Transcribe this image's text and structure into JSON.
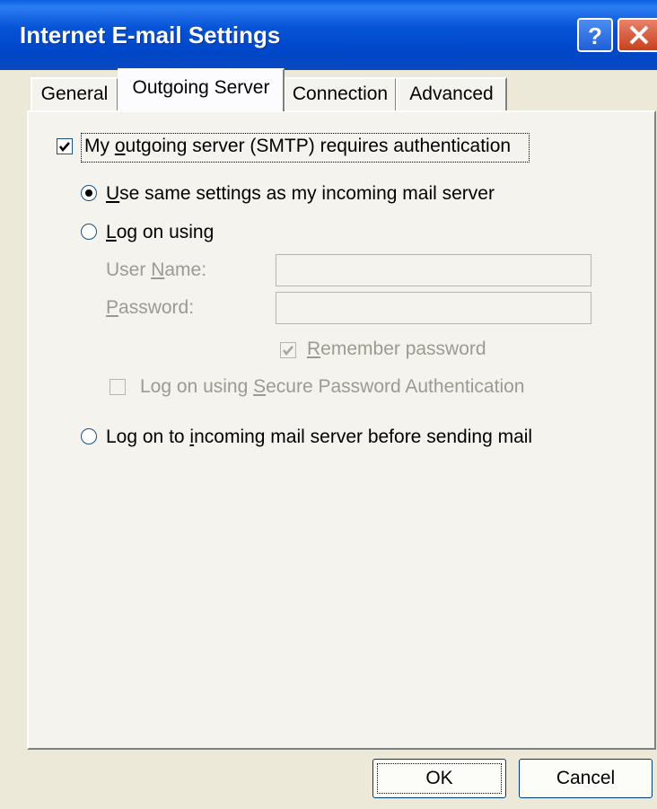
{
  "window": {
    "title": "Internet E-mail Settings"
  },
  "titlebar_buttons": {
    "help": "help-icon",
    "close": "close-icon"
  },
  "tabs": [
    {
      "label": "General",
      "selected": false
    },
    {
      "label": "Outgoing Server",
      "selected": true
    },
    {
      "label": "Connection",
      "selected": false
    },
    {
      "label": "Advanced",
      "selected": false
    }
  ],
  "outgoing": {
    "requires_auth": {
      "label_pre": "My ",
      "label_acc": "o",
      "label_post": "utgoing server (SMTP) requires authentication",
      "checked": true
    },
    "same_settings": {
      "label_acc": "U",
      "label_post": "se same settings as my incoming mail server",
      "selected": true
    },
    "log_on_using": {
      "label_acc": "L",
      "label_post": "og on using",
      "selected": false
    },
    "user_name": {
      "label_pre": "User ",
      "label_acc": "N",
      "label_post": "ame:",
      "value": ""
    },
    "password": {
      "label_acc": "P",
      "label_post": "assword:",
      "value": ""
    },
    "remember_password": {
      "label_acc": "R",
      "label_post": "emember password",
      "checked": true
    },
    "spa": {
      "label_pre": "Log on using ",
      "label_acc": "S",
      "label_post": "ecure Password Authentication",
      "checked": false
    },
    "log_on_incoming": {
      "label_pre": "Log on to ",
      "label_acc": "i",
      "label_post": "ncoming mail server before sending mail",
      "selected": false
    }
  },
  "buttons": {
    "ok": "OK",
    "cancel": "Cancel"
  }
}
